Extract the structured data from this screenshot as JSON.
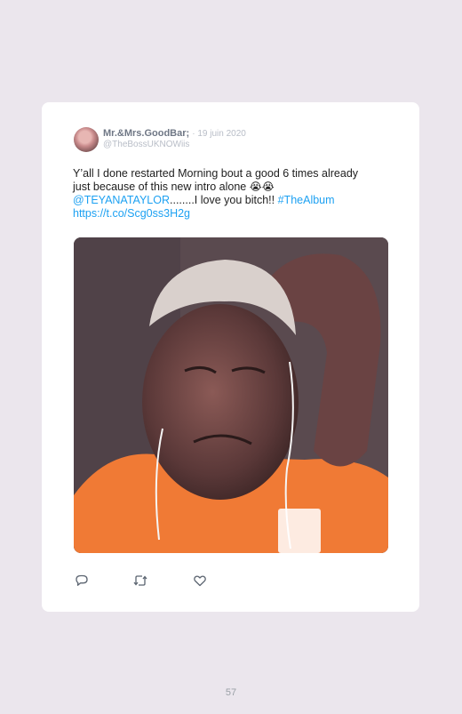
{
  "tweet": {
    "author_name": "Mr.&Mrs.GoodBar;",
    "date": "· 19 juin 2020",
    "handle": "@TheBossUKNOWiis",
    "text_line1": "Y’all I done restarted Morning bout a good 6 times already",
    "text_line2": "just because of this new intro alone",
    "emoji": "😭😭",
    "mention": "@TEYANATAYLOR",
    "mid_text": "........I love you bitch!! ",
    "hashtag": "#TheAlbum",
    "url": "https://t.co/Scg0ss3H2g",
    "media_icon": "gif-image",
    "actions": {
      "reply_icon": "reply-icon",
      "retweet_icon": "retweet-icon",
      "like_icon": "like-icon"
    }
  },
  "page": {
    "number": "57"
  },
  "colors": {
    "page_bg": "#ebe6ed",
    "card_bg": "#ffffff",
    "link": "#1da1f2",
    "name": "#6f7785",
    "muted": "#b8bdc7"
  }
}
